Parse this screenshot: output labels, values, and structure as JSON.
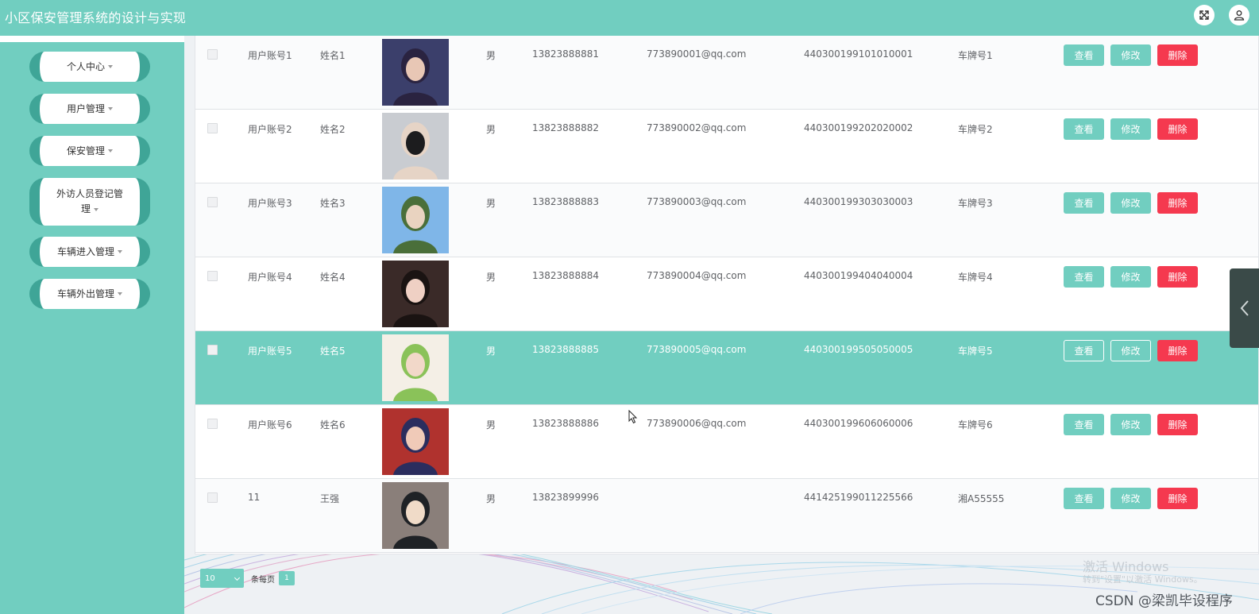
{
  "header": {
    "title": "小区保安管理系统的设计与实现"
  },
  "sidebar": {
    "items": [
      {
        "label": "个人中心"
      },
      {
        "label": "用户管理"
      },
      {
        "label": "保安管理"
      },
      {
        "label": "外访人员登记管理"
      },
      {
        "label": "车辆进入管理"
      },
      {
        "label": "车辆外出管理"
      }
    ]
  },
  "table": {
    "actions": {
      "view": "查看",
      "edit": "修改",
      "delete": "删除"
    },
    "rows": [
      {
        "account": "用户账号1",
        "name": "姓名1",
        "gender": "男",
        "phone": "13823888881",
        "email": "773890001@qq.com",
        "id_number": "440300199101010001",
        "plate": "车牌号1",
        "selected": false
      },
      {
        "account": "用户账号2",
        "name": "姓名2",
        "gender": "男",
        "phone": "13823888882",
        "email": "773890002@qq.com",
        "id_number": "440300199202020002",
        "plate": "车牌号2",
        "selected": false
      },
      {
        "account": "用户账号3",
        "name": "姓名3",
        "gender": "男",
        "phone": "13823888883",
        "email": "773890003@qq.com",
        "id_number": "440300199303030003",
        "plate": "车牌号3",
        "selected": false
      },
      {
        "account": "用户账号4",
        "name": "姓名4",
        "gender": "男",
        "phone": "13823888884",
        "email": "773890004@qq.com",
        "id_number": "440300199404040004",
        "plate": "车牌号4",
        "selected": false
      },
      {
        "account": "用户账号5",
        "name": "姓名5",
        "gender": "男",
        "phone": "13823888885",
        "email": "773890005@qq.com",
        "id_number": "440300199505050005",
        "plate": "车牌号5",
        "selected": true
      },
      {
        "account": "用户账号6",
        "name": "姓名6",
        "gender": "男",
        "phone": "13823888886",
        "email": "773890006@qq.com",
        "id_number": "440300199606060006",
        "plate": "车牌号6",
        "selected": false
      },
      {
        "account": "11",
        "name": "王强",
        "gender": "男",
        "phone": "13823899996",
        "email": "",
        "id_number": "441425199011225566",
        "plate": "湘A55555",
        "selected": false
      }
    ]
  },
  "pagination": {
    "page_size": "10",
    "per_page_label": "条每页",
    "current_page": "1"
  },
  "watermark": {
    "line1": "激活 Windows",
    "line2": "转到\"设置\"以激活 Windows。",
    "credit": "CSDN @梁凯毕设程序"
  },
  "colors": {
    "primary": "#71cec0",
    "danger": "#f5394f",
    "menu_accent": "#3fa597"
  }
}
